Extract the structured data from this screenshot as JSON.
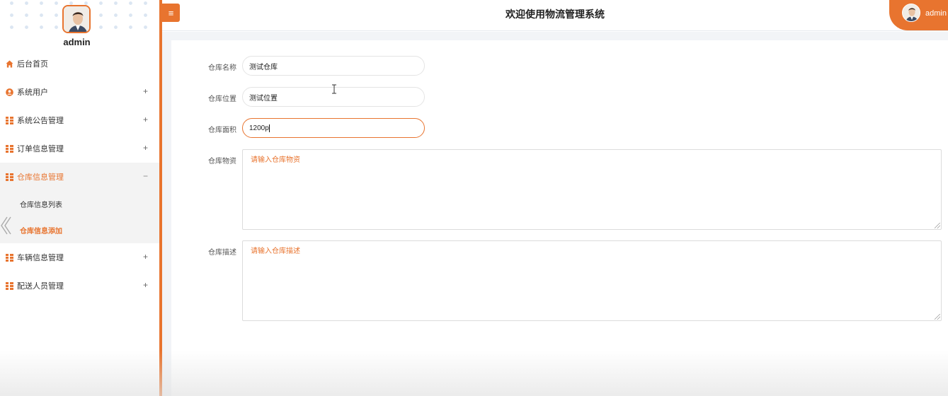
{
  "app": {
    "title": "欢迎使用物流管理系统",
    "accent": "#e8742f"
  },
  "header": {
    "menu_toggle_icon": "hamburger-icon",
    "user_name": "admin"
  },
  "sidebar": {
    "user_name": "admin",
    "items": [
      {
        "label": "后台首页",
        "icon": "home-icon",
        "sign": ""
      },
      {
        "label": "系统用户",
        "icon": "user-circle-icon",
        "sign": "+"
      },
      {
        "label": "系统公告管理",
        "icon": "grid-icon",
        "sign": "+"
      },
      {
        "label": "订单信息管理",
        "icon": "grid-icon",
        "sign": "+"
      },
      {
        "label": "仓库信息管理",
        "icon": "grid-icon",
        "sign": "−",
        "children": [
          {
            "label": "仓库信息列表"
          },
          {
            "label": "仓库信息添加"
          }
        ]
      },
      {
        "label": "车辆信息管理",
        "icon": "grid-icon",
        "sign": "+"
      },
      {
        "label": "配送人员管理",
        "icon": "grid-icon",
        "sign": "+"
      }
    ]
  },
  "form": {
    "name": {
      "label": "仓库名称",
      "value": "测试仓库"
    },
    "location": {
      "label": "仓库位置",
      "value": "测试位置"
    },
    "area": {
      "label": "仓库面积",
      "value": "1200p"
    },
    "supplies": {
      "label": "仓库物资",
      "placeholder": "请输入仓库物资"
    },
    "desc": {
      "label": "仓库描述",
      "placeholder": "请输入仓库描述"
    }
  }
}
